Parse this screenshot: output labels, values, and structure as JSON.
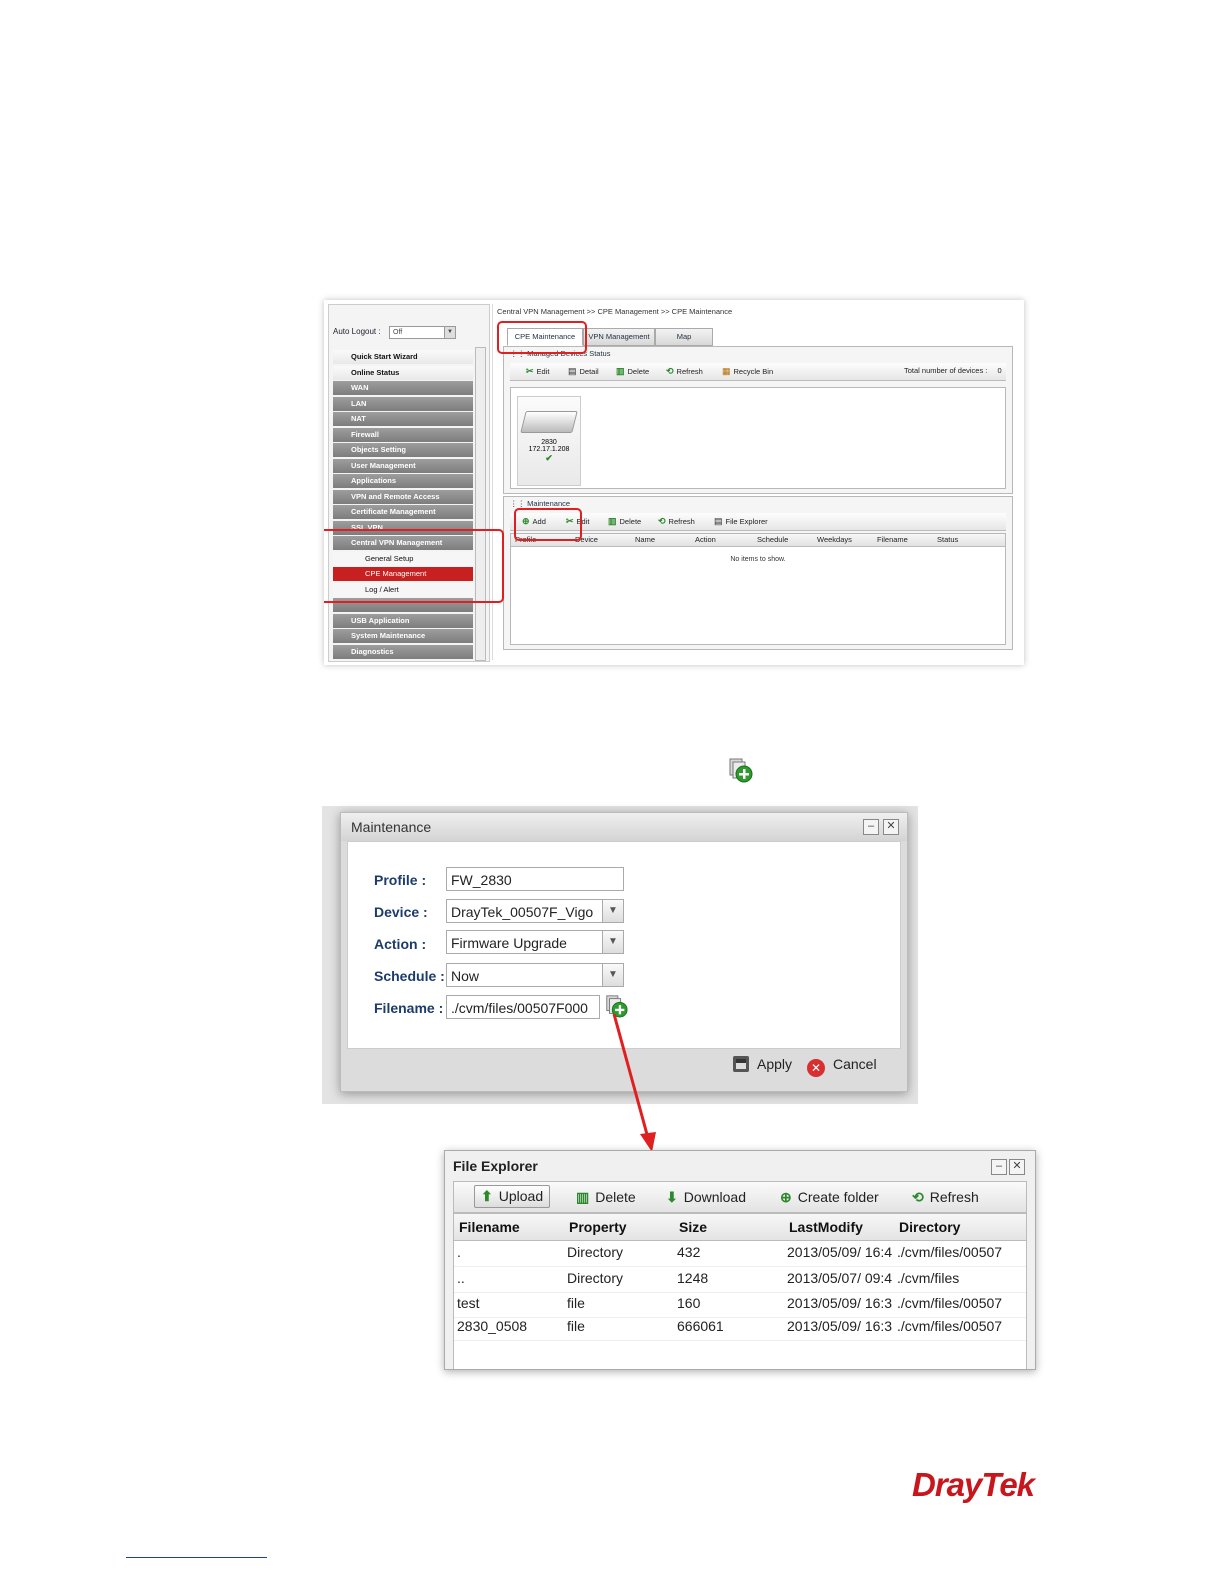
{
  "shot1": {
    "auto_logout_label": "Auto Logout :",
    "auto_logout_value": "Off",
    "menu": [
      {
        "label": "Quick Start Wizard",
        "style": "light"
      },
      {
        "label": "Online Status",
        "style": "light"
      },
      {
        "label": "WAN",
        "style": "dark"
      },
      {
        "label": "LAN",
        "style": "dark"
      },
      {
        "label": "NAT",
        "style": "dark"
      },
      {
        "label": "Firewall",
        "style": "dark"
      },
      {
        "label": "Objects Setting",
        "style": "dark"
      },
      {
        "label": "User Management",
        "style": "dark"
      },
      {
        "label": "Applications",
        "style": "dark"
      },
      {
        "label": "VPN and Remote Access",
        "style": "dark"
      },
      {
        "label": "Certificate Management",
        "style": "dark"
      },
      {
        "label": "SSL VPN",
        "style": "dark"
      },
      {
        "label": "Central VPN Management",
        "style": "dark"
      },
      {
        "label": "General Setup",
        "style": "sub"
      },
      {
        "label": "CPE Management",
        "style": "active"
      },
      {
        "label": "Log / Alert",
        "style": "sub"
      },
      {
        "label": "",
        "style": "dark"
      },
      {
        "label": "USB Application",
        "style": "dark"
      },
      {
        "label": "System Maintenance",
        "style": "dark"
      },
      {
        "label": "Diagnostics",
        "style": "dark"
      }
    ],
    "breadcrumb": "Central VPN Management >> CPE Management >> CPE Maintenance",
    "tabs": [
      "CPE Maintenance",
      "VPN Management",
      "Map"
    ],
    "devices_panel_title": "Managed Devices Status",
    "devices_toolbar": [
      "Edit",
      "Detail",
      "Delete",
      "Refresh",
      "Recycle Bin"
    ],
    "total_devices_label": "Total number of devices :",
    "total_devices_value": "0",
    "device": {
      "name": "2830",
      "ip": "172.17.1.208"
    },
    "maint_panel_title": "Maintenance",
    "maint_toolbar": [
      "Add",
      "Edit",
      "Delete",
      "Refresh",
      "File Explorer"
    ],
    "maint_columns": [
      "Profile",
      "Device",
      "Name",
      "Action",
      "Schedule",
      "Weekdays",
      "Filename",
      "Status"
    ],
    "no_items": "No items to show."
  },
  "dialog": {
    "title": "Maintenance",
    "fields": {
      "profile_label": "Profile :",
      "profile_value": "FW_2830",
      "device_label": "Device :",
      "device_value": "DrayTek_00507F_Vigo",
      "action_label": "Action :",
      "action_value": "Firmware Upgrade",
      "schedule_label": "Schedule :",
      "schedule_value": "Now",
      "filename_label": "Filename :",
      "filename_value": "./cvm/files/00507F000"
    },
    "apply": "Apply",
    "cancel": "Cancel"
  },
  "file_explorer": {
    "title": "File Explorer",
    "toolbar": [
      "Upload",
      "Delete",
      "Download",
      "Create folder",
      "Refresh"
    ],
    "columns": [
      "Filename",
      "Property",
      "Size",
      "LastModify",
      "Directory"
    ],
    "rows": [
      [
        ".",
        "Directory",
        "432",
        "2013/05/09/ 16:4",
        "./cvm/files/00507"
      ],
      [
        "..",
        "Directory",
        "1248",
        "2013/05/07/ 09:4",
        "./cvm/files"
      ],
      [
        "test",
        "file",
        "160",
        "2013/05/09/ 16:3",
        "./cvm/files/00507"
      ],
      [
        "2830_0508",
        "file",
        "666061",
        "2013/05/09/ 16:3",
        "./cvm/files/00507"
      ]
    ]
  },
  "brand": "DrayTek",
  "colors": {
    "accent_red": "#e02020",
    "brand_red": "#c8161d",
    "menu_active": "#c62020"
  }
}
